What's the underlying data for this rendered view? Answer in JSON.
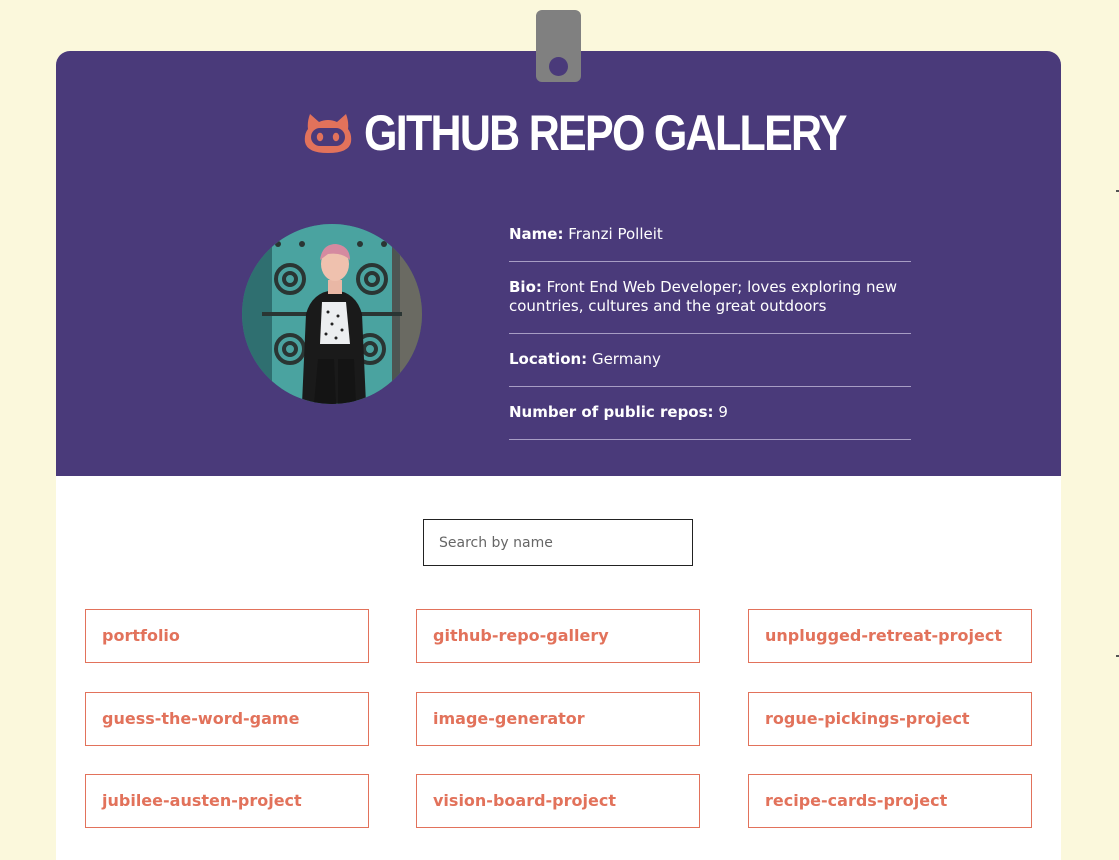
{
  "header": {
    "title": "GITHUB REPO GALLERY",
    "icon": "github-octocat-icon",
    "accent_color": "#e2725b",
    "background_color": "#4a3a7a"
  },
  "profile": {
    "avatar_alt": "Franzi Polleit",
    "name_label": "Name:",
    "name": "Franzi Polleit",
    "bio_label": "Bio:",
    "bio": "Front End Web Developer; loves exploring new countries, cultures and the great outdoors",
    "location_label": "Location:",
    "location": "Germany",
    "repos_label": "Number of public repos:",
    "repos_count": "9"
  },
  "search": {
    "placeholder": "Search by name",
    "value": ""
  },
  "repos": [
    "portfolio",
    "github-repo-gallery",
    "unplugged-retreat-project",
    "guess-the-word-game",
    "image-generator",
    "rogue-pickings-project",
    "jubilee-austen-project",
    "vision-board-project",
    "recipe-cards-project"
  ]
}
